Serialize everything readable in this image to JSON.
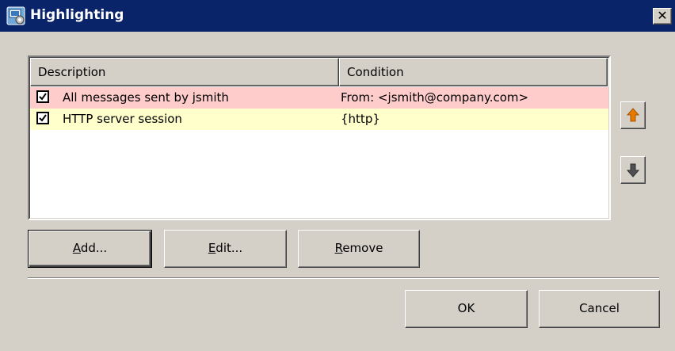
{
  "window": {
    "title": "Highlighting",
    "close_glyph": "✕"
  },
  "list": {
    "columns": [
      "Description",
      "Condition"
    ],
    "rows": [
      {
        "checked": true,
        "description": "All messages sent by jsmith",
        "condition": "From: <jsmith@company.com>",
        "bg": "#ffcccc"
      },
      {
        "checked": true,
        "description": "HTTP server session",
        "condition": "{http}",
        "bg": "#ffffcc"
      }
    ]
  },
  "side_buttons": {
    "up_icon": "arrow-up-icon",
    "up_color": "#e87a00",
    "down_icon": "arrow-down-icon",
    "down_color": "#505050"
  },
  "actions": {
    "add_label_mn": "A",
    "add_label_rest": "dd...",
    "edit_label_mn": "E",
    "edit_label_rest": "dit...",
    "remove_label_mn": "R",
    "remove_label_rest": "emove"
  },
  "dialog": {
    "ok_label": "OK",
    "cancel_label": "Cancel"
  },
  "colors": {
    "titlebar": "#0a246a",
    "face": "#d4d0c8"
  }
}
